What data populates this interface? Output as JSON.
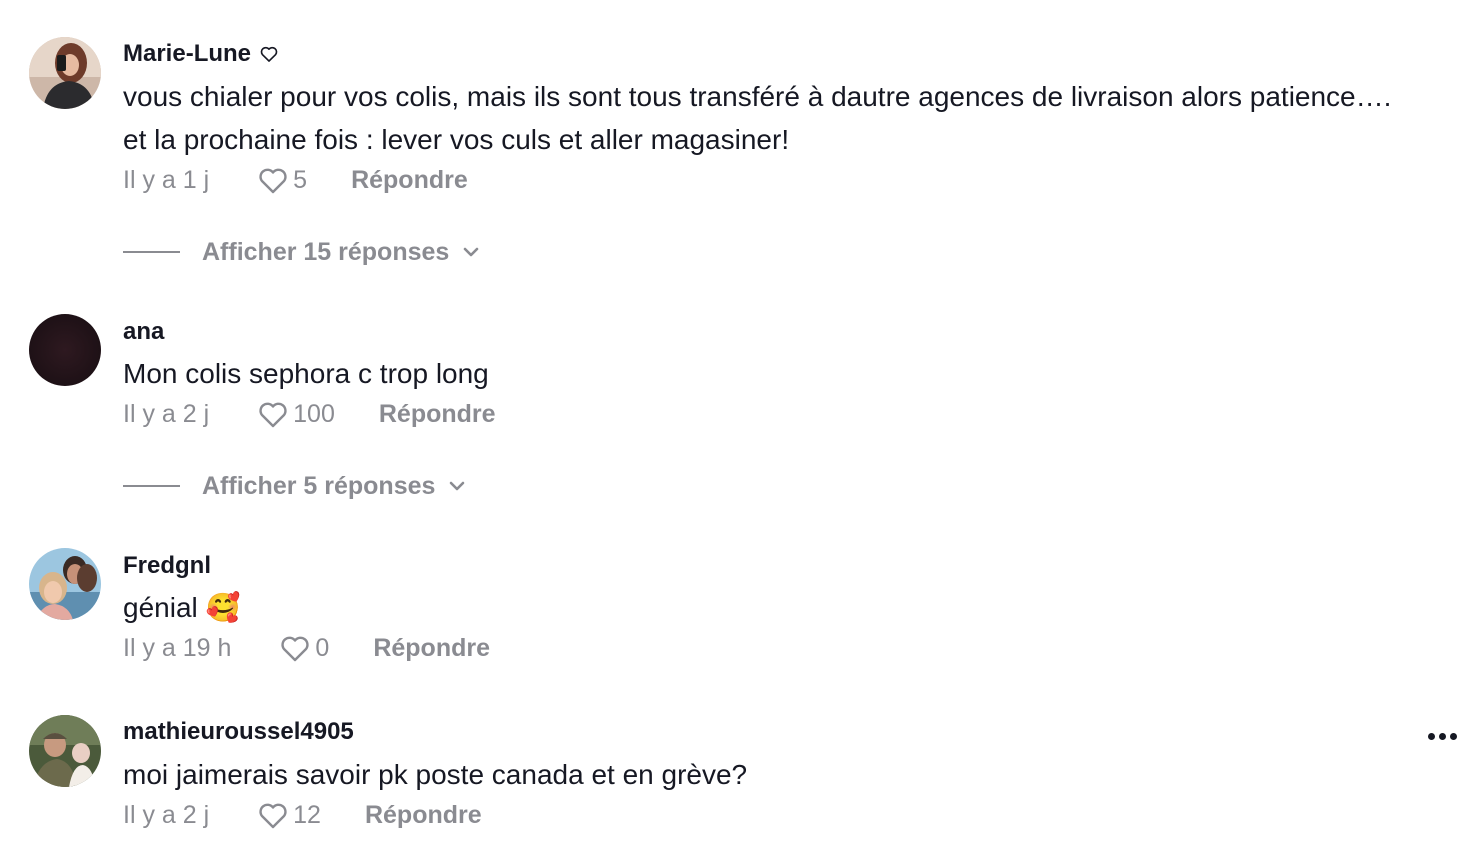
{
  "comments": [
    {
      "username": "Marie-Lune",
      "text_lines": [
        "vous chialer pour vos colis, mais ils sont tous transféré à dautre agences de livraison alors patience….",
        "et la prochaine fois : lever vos culs et aller magasiner!"
      ],
      "time": "Il y a 1 j",
      "likes": "5",
      "reply_label": "Répondre",
      "view_replies": "Afficher 15 réponses"
    },
    {
      "username": "ana",
      "text_lines": [
        "Mon colis sephora c trop long"
      ],
      "time": "Il y a 2 j",
      "likes": "100",
      "reply_label": "Répondre",
      "view_replies": "Afficher 5 réponses"
    },
    {
      "username": "Fredgnl",
      "text_lines": [
        "génial 🥰"
      ],
      "time": "Il y a 19 h",
      "likes": "0",
      "reply_label": "Répondre"
    },
    {
      "username": "mathieuroussel4905",
      "text_lines": [
        "moi jaimerais savoir pk poste canada et en grève?"
      ],
      "time": "Il y a 2 j",
      "likes": "12",
      "reply_label": "Répondre"
    }
  ],
  "icons": {
    "creator_badge": "heart-outline-icon",
    "like": "heart-outline-icon",
    "expand": "chevron-down-icon",
    "more": "more-dots-icon"
  },
  "colors": {
    "text_primary": "#161823",
    "text_secondary": "#8a8b91"
  }
}
